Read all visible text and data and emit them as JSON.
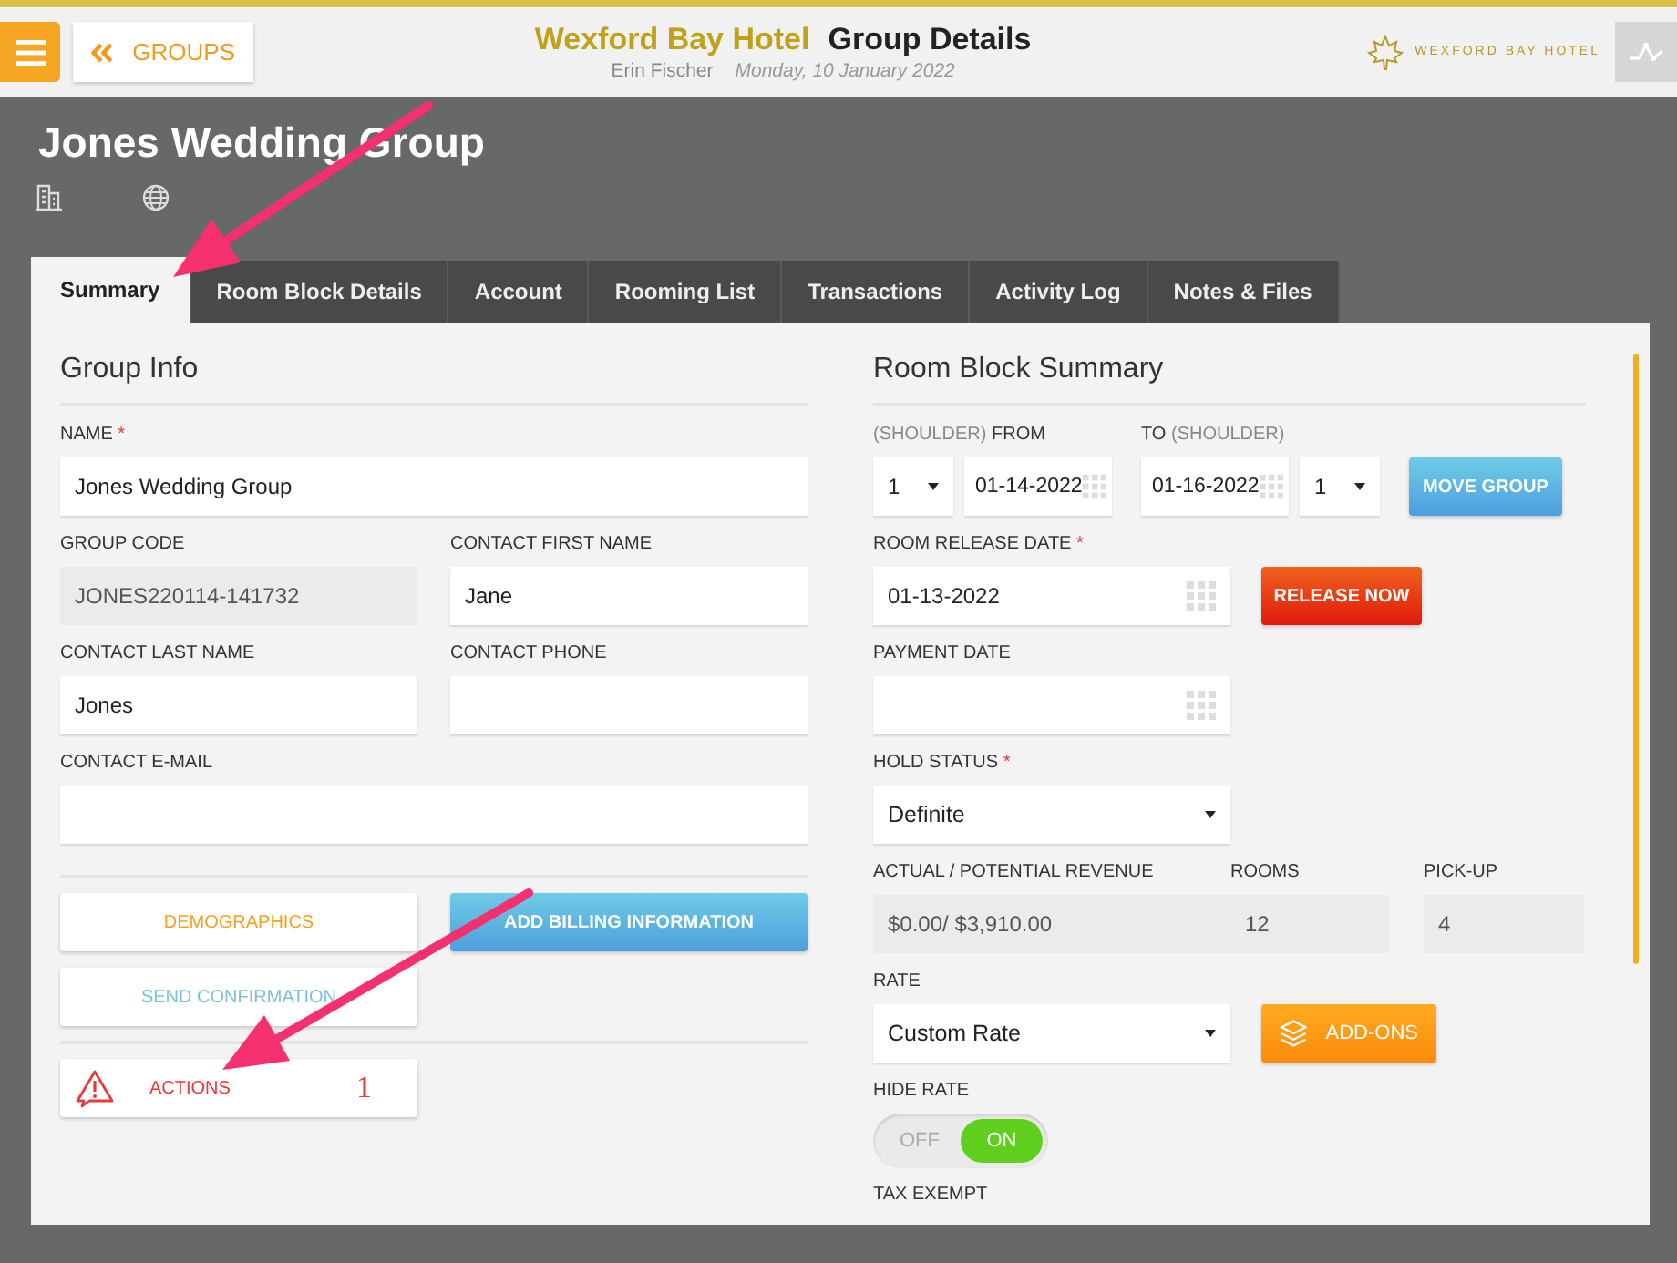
{
  "header": {
    "back_button": "GROUPS",
    "hotel_name": "Wexford Bay Hotel",
    "page_title": "Group Details",
    "user": "Erin Fischer",
    "date": "Monday, 10 January 2022",
    "logo_text": "WEXFORD BAY HOTEL"
  },
  "group_title": "Jones Wedding Group",
  "tabs": [
    {
      "label": "Summary",
      "selected": true
    },
    {
      "label": "Room Block Details",
      "selected": false
    },
    {
      "label": "Account",
      "selected": false
    },
    {
      "label": "Rooming List",
      "selected": false
    },
    {
      "label": "Transactions",
      "selected": false
    },
    {
      "label": "Activity Log",
      "selected": false
    },
    {
      "label": "Notes & Files",
      "selected": false
    }
  ],
  "group_info": {
    "title": "Group Info",
    "name": {
      "label": "NAME",
      "mark": "*",
      "value": "Jones Wedding Group",
      "disabled": false
    },
    "group_code": {
      "label": "GROUP CODE",
      "value": "JONES220114-141732",
      "disabled": true
    },
    "contact_first_name": {
      "label": "CONTACT FIRST NAME",
      "value": "Jane",
      "disabled": false
    },
    "contact_last_name": {
      "label": "CONTACT LAST NAME",
      "value": "Jones",
      "disabled": false
    },
    "contact_phone": {
      "label": "CONTACT PHONE",
      "disabled": false
    },
    "contact_email": {
      "label": "CONTACT E-MAIL",
      "disabled": false
    },
    "buttons": [
      {
        "label": "DEMOGRAPHICS",
        "kind": "secondary"
      },
      {
        "label": "ADD BILLING INFORMATION",
        "kind": "primary"
      },
      {
        "label": "SEND CONFIRMATION",
        "kind": "info"
      }
    ],
    "actions": {
      "label": "ACTIONS",
      "count": "1"
    }
  },
  "room_block": {
    "title": "Room Block Summary",
    "from_label": {
      "prefix": "(SHOULDER)",
      "text": "FROM"
    },
    "to_label": {
      "text": "TO",
      "suffix": "(SHOULDER)"
    },
    "from_shoulder": "1",
    "from_date": "01-14-2022",
    "to_date": "01-16-2022",
    "to_shoulder": "1",
    "move_button": "MOVE GROUP",
    "release_date": {
      "label": "ROOM RELEASE DATE",
      "mark": "*",
      "value": "01-13-2022"
    },
    "release_button": "RELEASE NOW",
    "payment_date": {
      "label": "PAYMENT DATE"
    },
    "hold_status": {
      "label": "HOLD STATUS",
      "mark": "*",
      "value": "Definite"
    },
    "revenue": {
      "label": "ACTUAL / POTENTIAL REVENUE",
      "value": "$0.00/ $3,910.00",
      "disabled": true
    },
    "rooms": {
      "label": "ROOMS",
      "value": "12",
      "disabled": true
    },
    "pickup": {
      "label": "PICK-UP",
      "value": "4",
      "disabled": true
    },
    "rate": {
      "label": "RATE",
      "value": "Custom Rate"
    },
    "addons_button": "ADD-ONS",
    "hide_rate": {
      "label": "HIDE RATE",
      "off_label": "OFF",
      "on_label": "ON",
      "on": true
    },
    "tax_exempt_label": "TAX EXEMPT"
  }
}
